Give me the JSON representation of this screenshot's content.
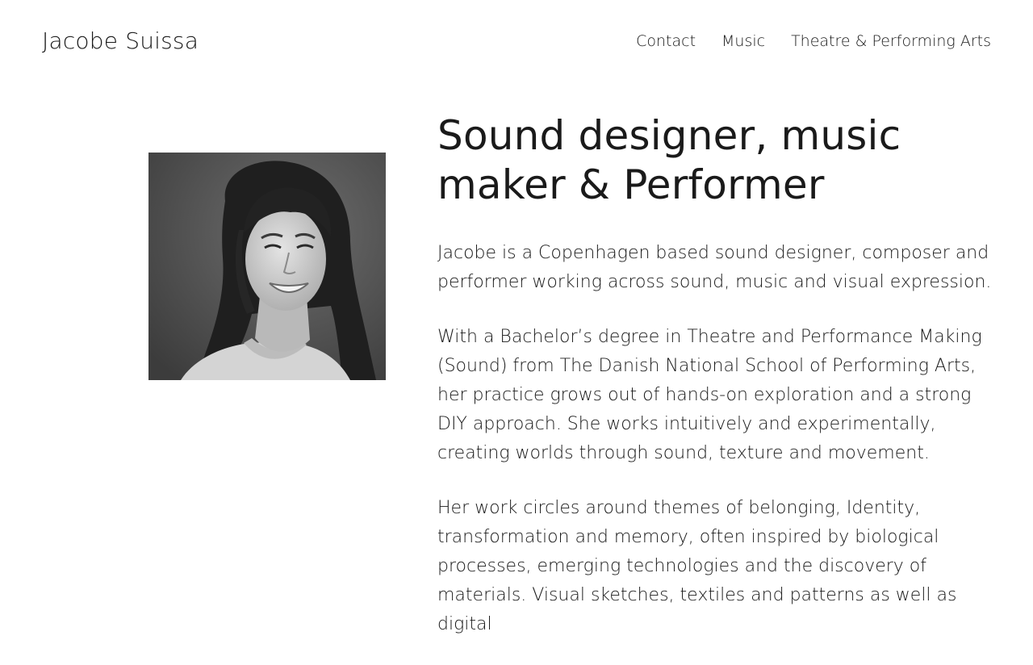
{
  "header": {
    "site_title": "Jacobe Suissa",
    "nav": [
      {
        "label": "Contact"
      },
      {
        "label": "Music"
      },
      {
        "label": "Theatre & Performing Arts"
      }
    ]
  },
  "main": {
    "headline": "Sound designer, music maker & Performer",
    "paragraphs": [
      "Jacobe is a Copenhagen based sound designer, composer and performer working across sound, music and visual expression.",
      "With a Bachelor’s degree in Theatre and Performance Making (Sound) from The Danish National School of Performing Arts, her practice grows out of hands-on exploration and a strong DIY approach. She works intuitively and experimentally, creating worlds through sound, texture and movement.",
      "Her work circles around themes of belonging, Identity, transformation and memory, often inspired by biological processes, emerging technologies and the discovery of materials. Visual sketches, textiles and patterns as well as digital"
    ],
    "portrait": {
      "style": "black-and-white",
      "colors": {
        "background": "#5c5c5c",
        "skin": "#cfcfcf",
        "hair": "#1e1e1e",
        "shirt": "#d6d6d6"
      }
    }
  }
}
